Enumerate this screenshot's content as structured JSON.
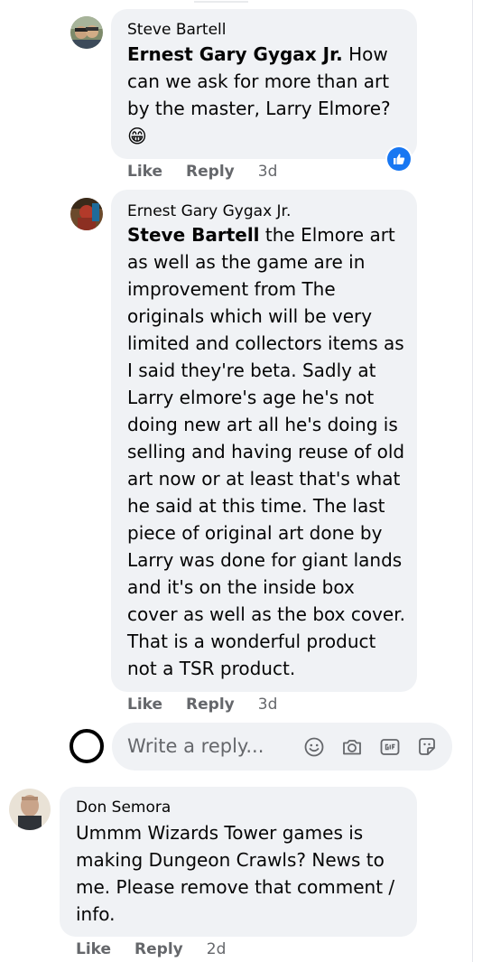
{
  "comments": [
    {
      "author": "Steve Bartell",
      "mention": "Ernest Gary Gygax Jr.",
      "text": " How can we ask for more than art by the master, Larry Elmore?",
      "emoji": "😁",
      "like": "Like",
      "reply": "Reply",
      "time": "3d",
      "reaction": "like"
    },
    {
      "author": "Ernest Gary Gygax Jr.",
      "mention": "Steve Bartell",
      "text": " the Elmore art as well as the game are in improvement from The originals which will be very limited and collectors items as I said they're beta. Sadly at Larry elmore's age he's not doing new art all he's doing is selling and having reuse of old art now or at least that's what he said at this time. The last piece of original art done by Larry was done for giant lands and it's on the inside box cover as well as the box cover. That is a wonderful product not a TSR product.",
      "like": "Like",
      "reply": "Reply",
      "time": "3d"
    },
    {
      "author": "Don Semora",
      "text": "Ummm Wizards Tower games is making Dungeon Crawls? News to me. Please remove that comment / info.",
      "like": "Like",
      "reply": "Reply",
      "time": "2d"
    }
  ],
  "reply_box": {
    "placeholder": "Write a reply...",
    "icons": [
      "emoji-icon",
      "camera-icon",
      "gif-icon",
      "sticker-icon"
    ]
  },
  "colors": {
    "bubble": "#f0f2f5",
    "muted_text": "#65676b",
    "like_blue": "#1877f2"
  }
}
